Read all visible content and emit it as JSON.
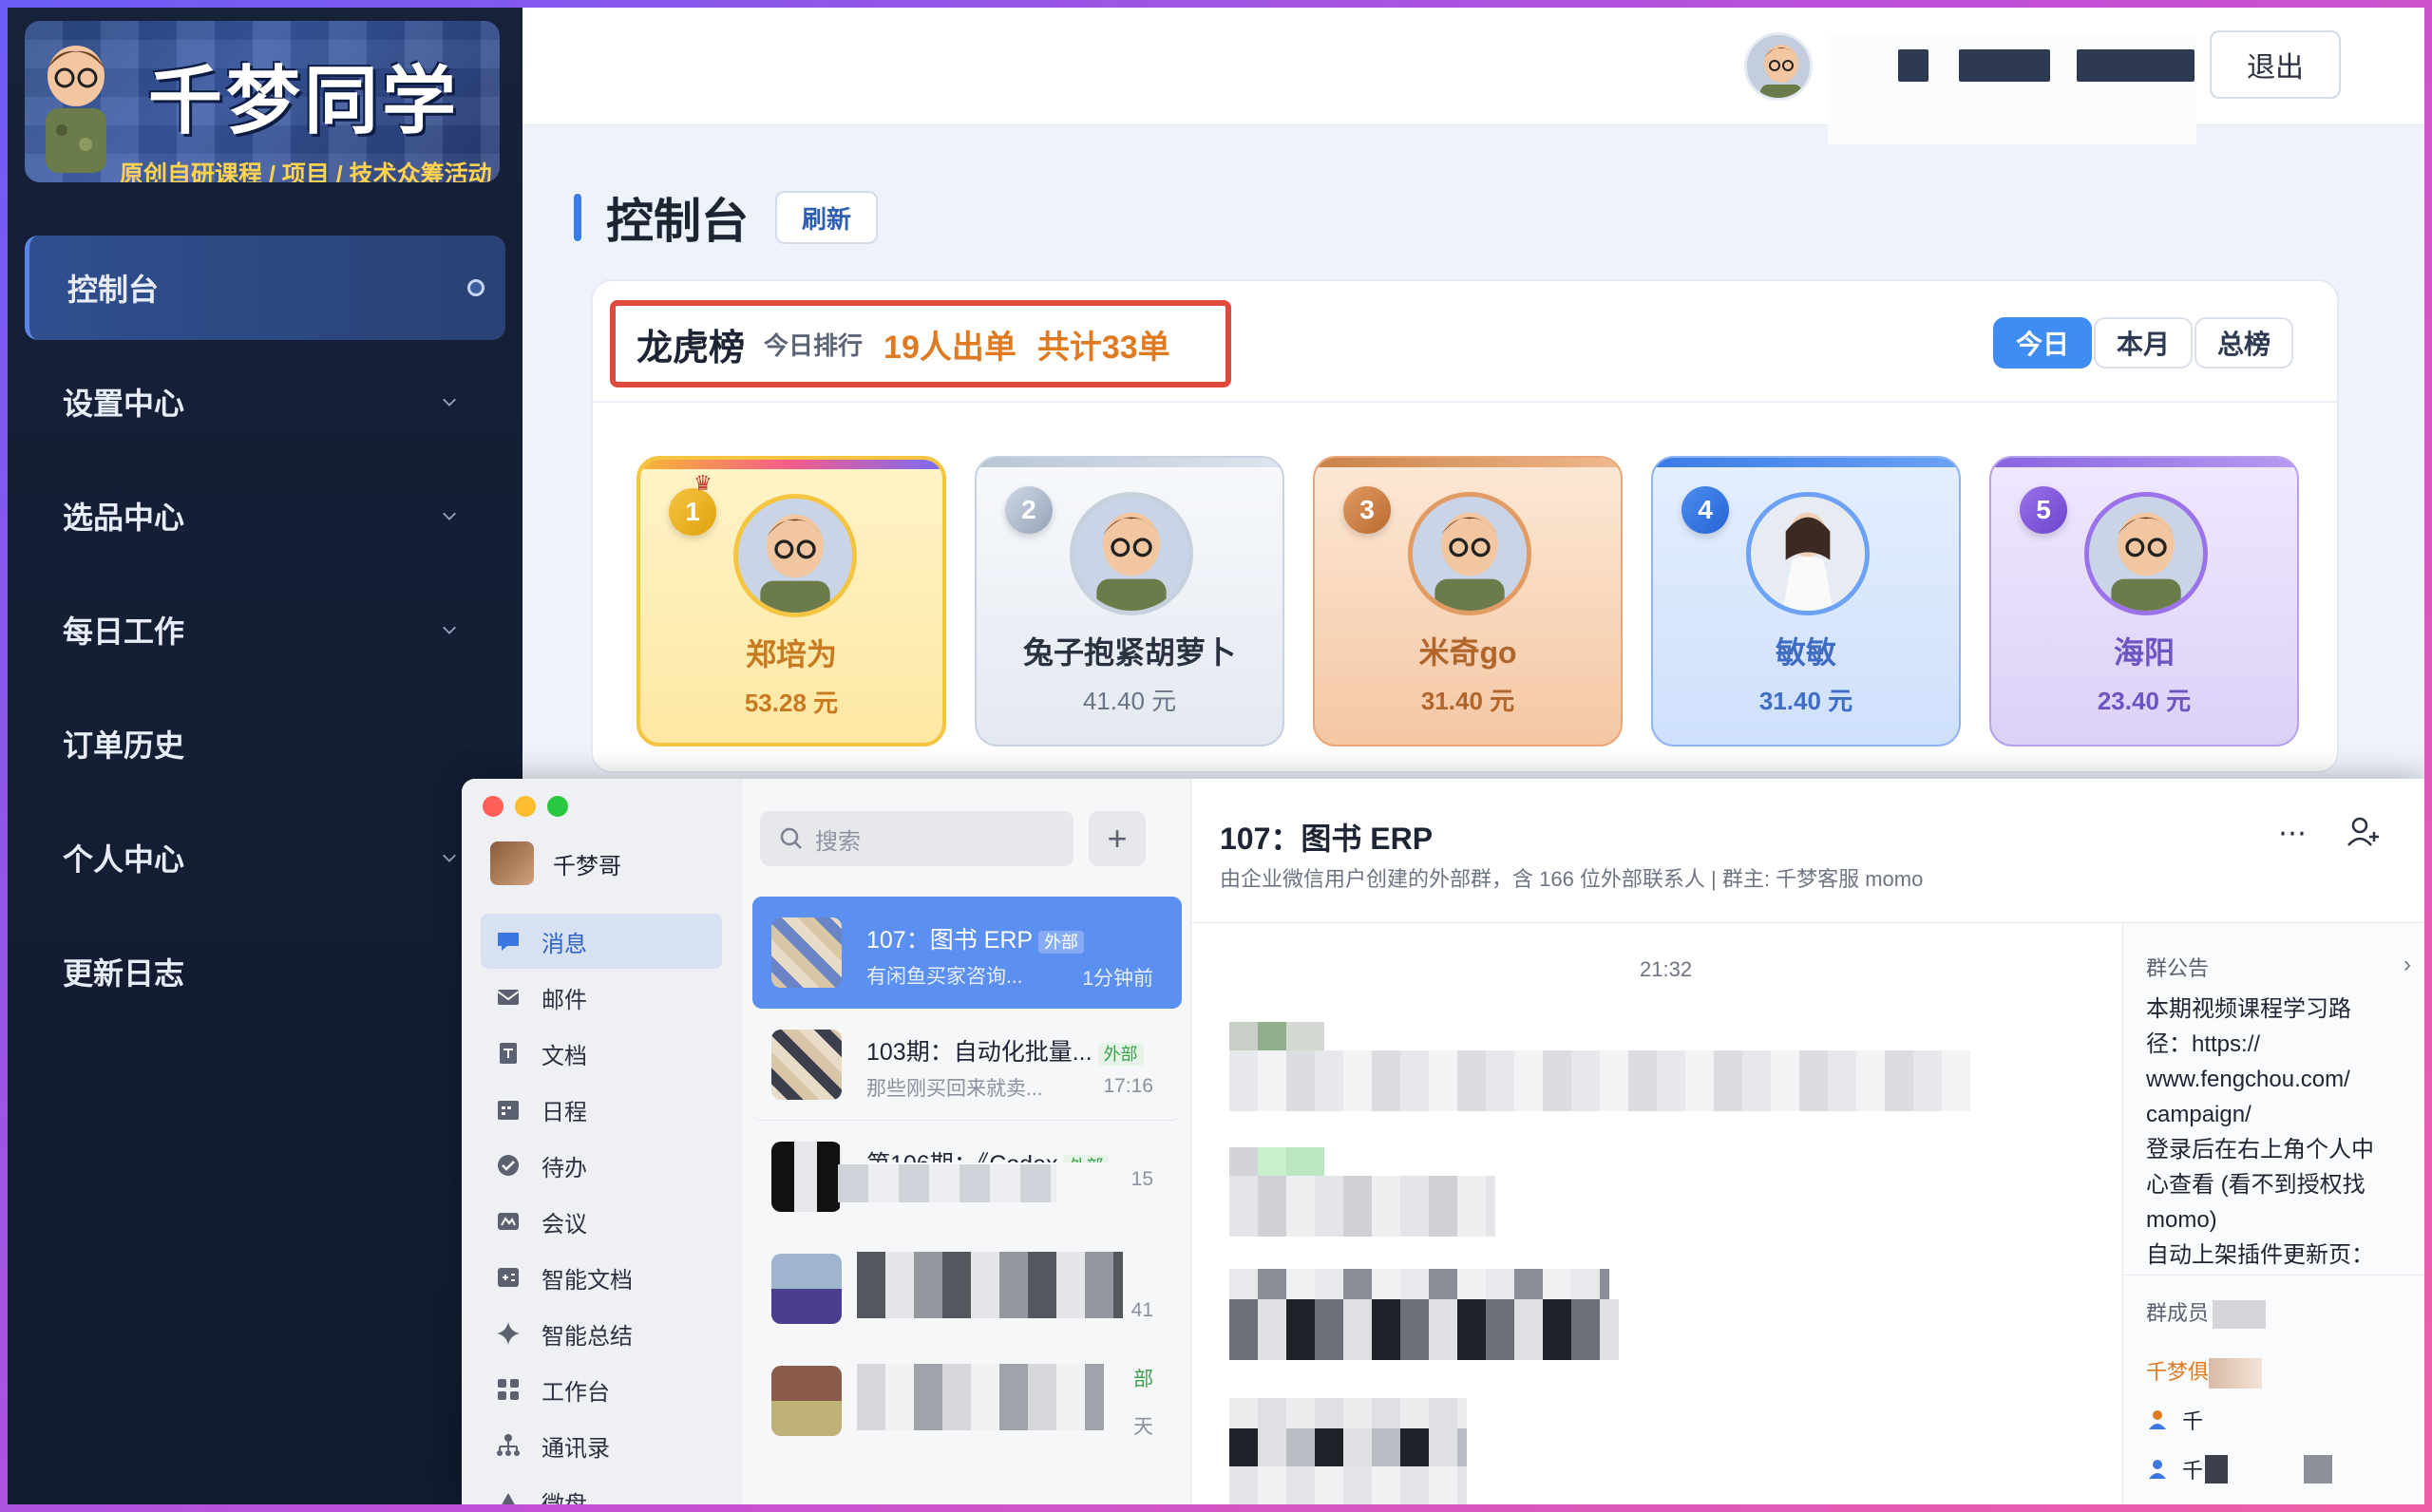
{
  "brand": {
    "title": "千梦同学",
    "subtitle": "原创自研课程 / 项目 / 技术众筹活动"
  },
  "sidebar": {
    "items": [
      {
        "label": "控制台",
        "active": true,
        "icon": "dot-indicator"
      },
      {
        "label": "设置中心",
        "icon": "chevron-down-icon"
      },
      {
        "label": "选品中心",
        "icon": "chevron-down-icon"
      },
      {
        "label": "每日工作",
        "icon": "chevron-down-icon"
      },
      {
        "label": "订单历史"
      },
      {
        "label": "个人中心",
        "icon": "chevron-down-icon"
      },
      {
        "label": "更新日志"
      }
    ]
  },
  "header": {
    "logout_label": "退出"
  },
  "page": {
    "title": "控制台",
    "refresh_label": "刷新"
  },
  "leaderboard": {
    "name": "龙虎榜",
    "sub": "今日排行",
    "stat_people": "19人出单",
    "stat_total": "共计33单",
    "tabs": [
      "今日",
      "本月",
      "总榜"
    ],
    "active_tab": "今日",
    "cards": [
      {
        "rank": "1",
        "name": "郑培为",
        "amount": "53.28 元",
        "theme": "gold"
      },
      {
        "rank": "2",
        "name": "兔子抱紧胡萝卜",
        "amount": "41.40 元",
        "theme": "silver"
      },
      {
        "rank": "3",
        "name": "米奇go",
        "amount": "31.40 元",
        "theme": "bronze"
      },
      {
        "rank": "4",
        "name": "敏敏",
        "amount": "31.40 元",
        "theme": "blue"
      },
      {
        "rank": "5",
        "name": "海阳",
        "amount": "23.40 元",
        "theme": "purple"
      }
    ]
  },
  "chat_app": {
    "user": "千梦哥",
    "menu": [
      "消息",
      "邮件",
      "文档",
      "日程",
      "待办",
      "会议",
      "智能文档",
      "智能总结",
      "工作台",
      "通讯录",
      "微盘"
    ],
    "search_placeholder": "搜索",
    "conversations": [
      {
        "title": "107：图书 ERP",
        "tag": "外部",
        "preview": "有闲鱼买家咨询...",
        "time": "1分钟前"
      },
      {
        "title": "103期：自动化批量...",
        "tag": "外部",
        "preview": "那些刚买回来就卖...",
        "time": "17:16"
      },
      {
        "title": "第106期：《Codex",
        "tag": "外部",
        "preview": "",
        "time": "15"
      },
      {
        "title": "",
        "tag": "",
        "preview": "",
        "time": "41"
      },
      {
        "title": "",
        "tag": "部",
        "preview": "",
        "time": "天"
      }
    ],
    "active_chat": {
      "title": "107：图书 ERP",
      "description": "由企业微信用户创建的外部群，含 166 位外部联系人 | 群主: 千梦客服 momo",
      "timestamp": "21:32"
    },
    "notice": {
      "heading": "群公告",
      "lines": [
        "本期视频课程学习路",
        "径：https://",
        "www.fengchou.com/",
        "campaign/",
        "登录后在右上角个人中",
        "心查看 (看不到授权找",
        " momo)",
        "自动上架插件更新页："
      ]
    },
    "members": {
      "heading": "群成员",
      "first": "千梦俱",
      "rows": [
        "千",
        "千"
      ]
    }
  }
}
